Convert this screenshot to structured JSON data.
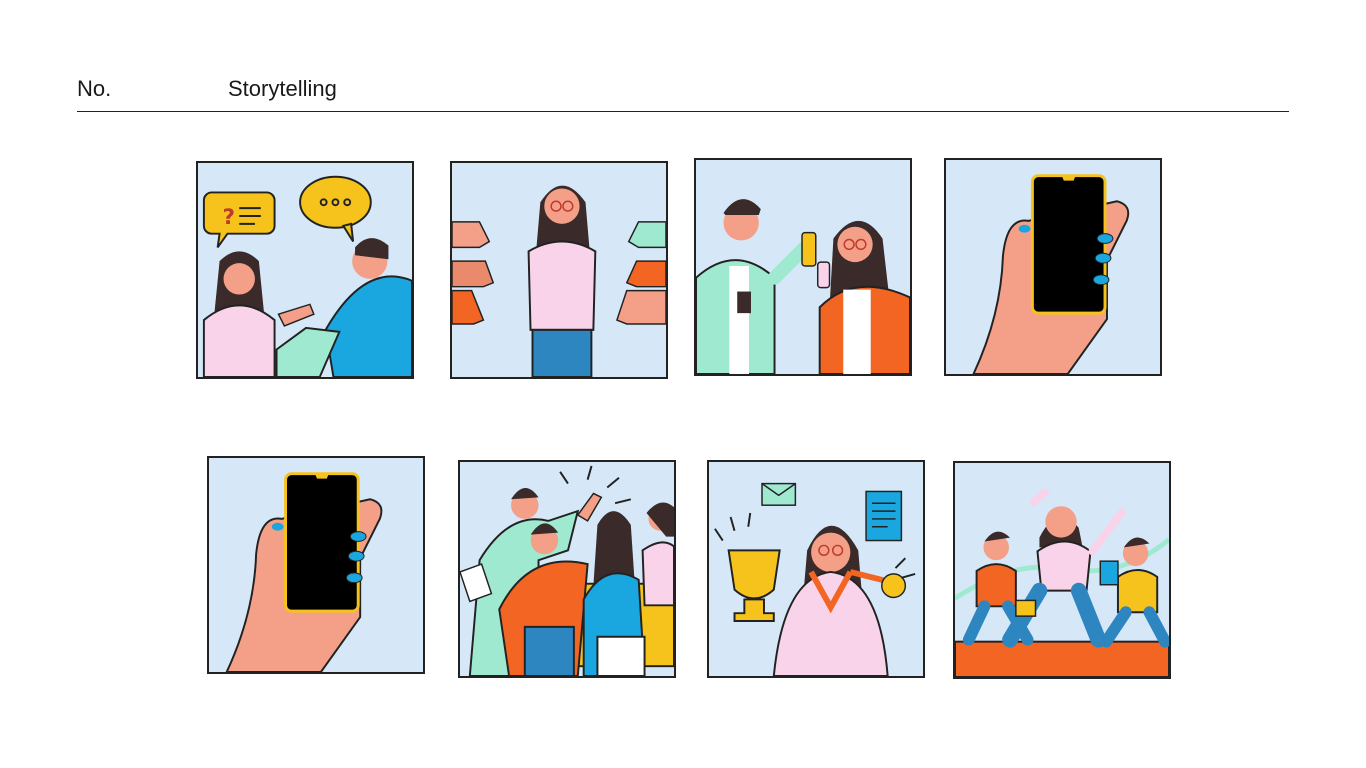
{
  "header": {
    "number_label": "No.",
    "title": "Storytelling"
  },
  "panels": [
    {
      "icon": "conversation-illustration"
    },
    {
      "icon": "thumbs-down-criticism-illustration"
    },
    {
      "icon": "sharing-phone-illustration"
    },
    {
      "icon": "hand-holding-phone-illustration"
    },
    {
      "icon": "hand-holding-phone-illustration"
    },
    {
      "icon": "team-high-five-illustration"
    },
    {
      "icon": "trophy-winner-illustration"
    },
    {
      "icon": "finish-line-race-illustration"
    }
  ],
  "colors": {
    "panel_bg": "#d6e8f8",
    "yellow": "#f5c31c",
    "orange": "#f26522",
    "blue": "#1aa7e0",
    "pink_shirt": "#f8d3ea",
    "mint": "#9ee9cf",
    "skin": "#f4a088",
    "hair": "#3a2a2a",
    "phone": "#000000"
  }
}
